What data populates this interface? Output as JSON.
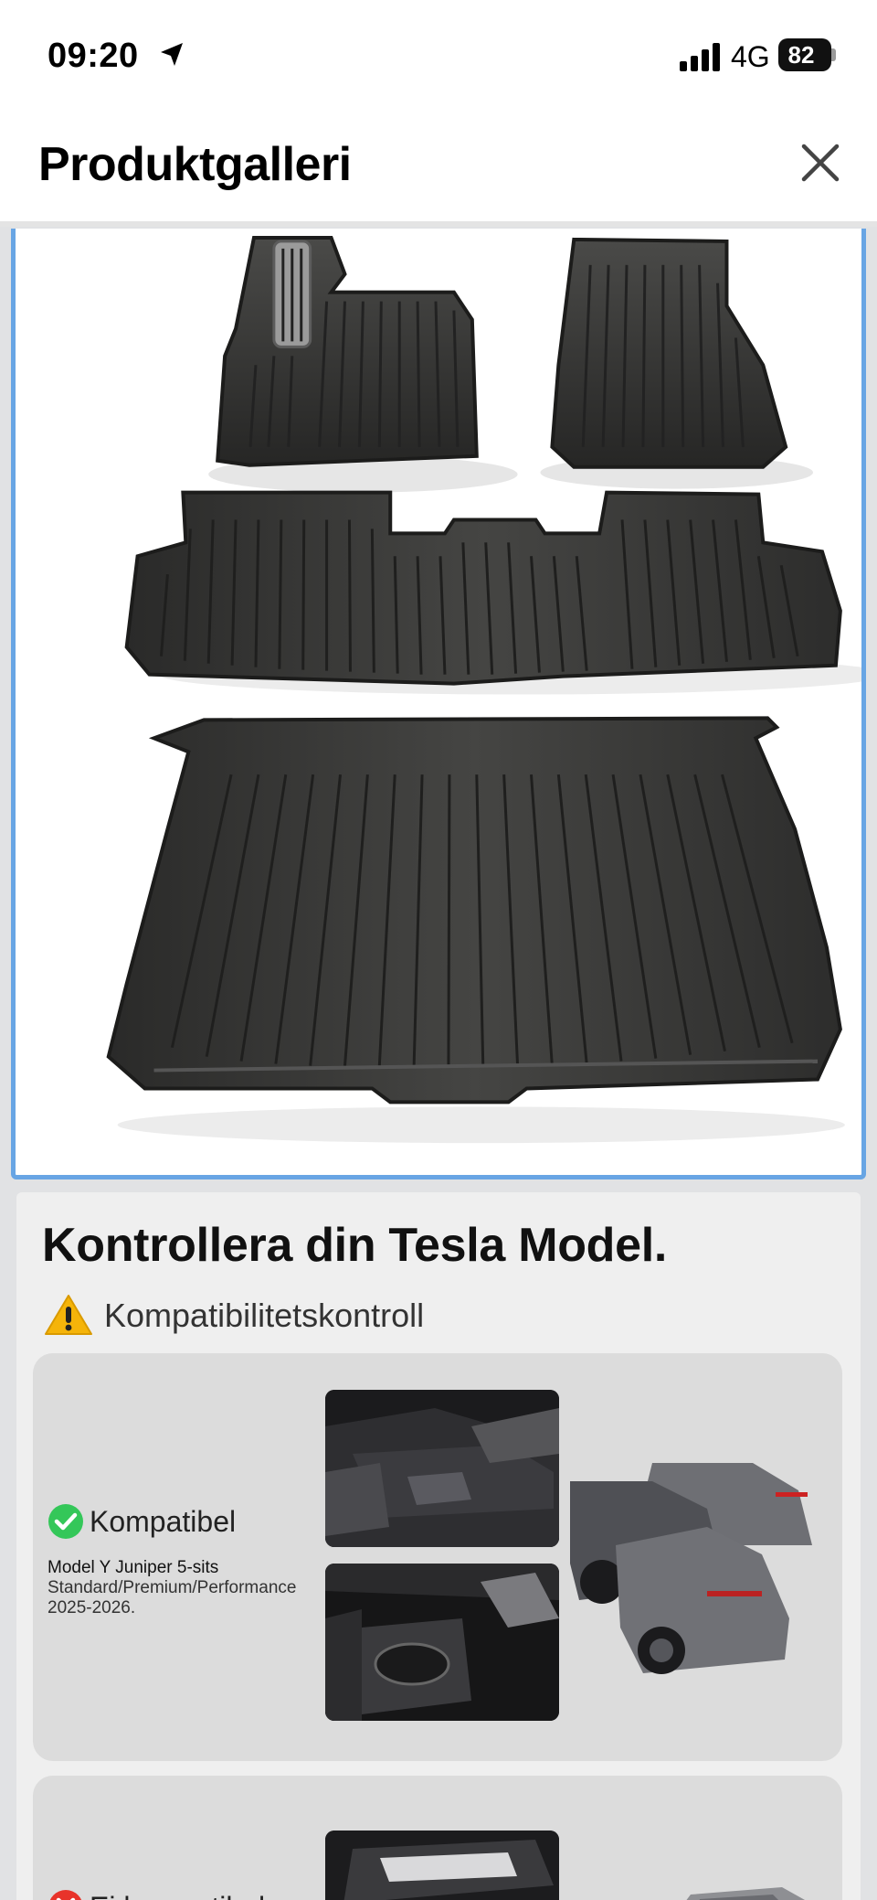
{
  "status_bar": {
    "time": "09:20",
    "network": "4G",
    "battery": "82",
    "icons": [
      "location-arrow-icon",
      "cellular-signal-icon",
      "battery-icon"
    ]
  },
  "header": {
    "title": "Produktgalleri",
    "close_icon": "close-icon"
  },
  "gallery": {
    "image_subject": "product-image",
    "selected_border_color": "#68a5e4"
  },
  "compatibility": {
    "heading": "Kontrollera din Tesla Model.",
    "check_label": "Kompatibilitetskontroll",
    "warning_icon": "warning-icon",
    "compatible": {
      "label": "Kompatibel",
      "icon": "check-circle-icon",
      "icon_color": "#34c759",
      "model": "Model Y Juniper 5-sits",
      "detail": "Standard/Premium/Performance 2025-2026."
    },
    "incompatible": {
      "label": "Ej kompatibel",
      "icon": "x-circle-icon",
      "icon_color": "#e8332a"
    }
  },
  "colors": {
    "background": "#e1e2e4",
    "card": "#efefef",
    "panel": "#dcdcdc"
  }
}
